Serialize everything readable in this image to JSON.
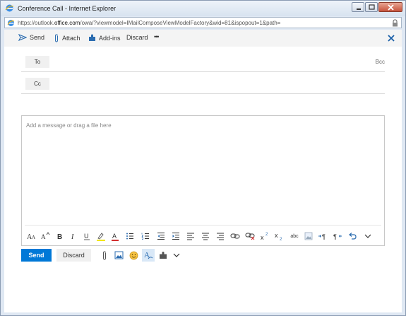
{
  "window": {
    "title": "Conference Call - Internet Explorer",
    "url_prefix": "https://outlook.",
    "url_domain": "office.com",
    "url_suffix": "/owa/?viewmodel=IMailComposeViewModelFactory&wid=81&ispopout=1&path="
  },
  "commandbar": {
    "send_label": "Send",
    "attach_label": "Attach",
    "addins_label": "Add-ins",
    "discard_label": "Discard",
    "more_label": "•••"
  },
  "recipients": {
    "to_label": "To",
    "cc_label": "Cc",
    "bcc_label": "Bcc"
  },
  "body": {
    "placeholder": "Add a message or drag a file here"
  },
  "formatting": {
    "strikethrough_label": "abc"
  },
  "actions": {
    "send_label": "Send",
    "discard_label": "Discard"
  },
  "colors": {
    "accent": "#0078d7",
    "icon_blue": "#2b6cb0"
  }
}
